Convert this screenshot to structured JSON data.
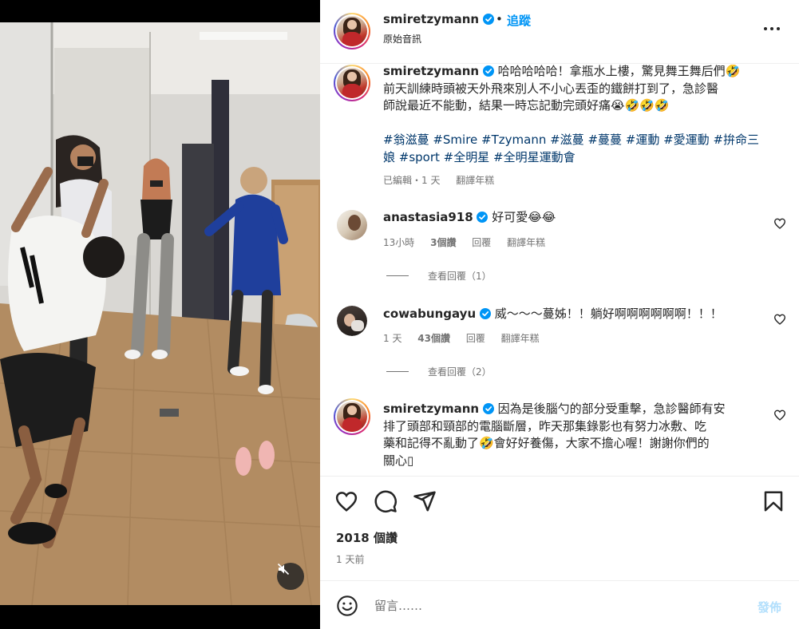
{
  "post": {
    "username": "smiretzymann",
    "follow_label": "追蹤",
    "dot": "•",
    "audio_label": "原始音訊",
    "more_icon": "more-horizontal-icon"
  },
  "caption": {
    "username": "smiretzymann",
    "line1": "哈哈哈哈哈！拿瓶水上樓，驚見舞王舞后們🤣",
    "line2": "前天訓練時頭被天外飛來別人不小心丟歪的鐵餅打到了，急診醫",
    "line3": "師說最近不能動，結果一時忘記動完頭好痛😭🤣🤣🤣",
    "hashtags_line1": "#翁滋蔓 #Smire #Tzymann #滋蔓 #蔓蔓 #運動 #愛運動 #拚命三",
    "hashtags_line2": "娘 #sport #全明星 #全明星運動會",
    "edited": "已編輯・1 天",
    "translate": "翻譯年糕"
  },
  "comments": [
    {
      "username": "anastasia918",
      "text": "好可愛😂😂",
      "time": "13小時",
      "likes": "3個讚",
      "reply": "回覆",
      "translate": "翻譯年糕",
      "view_replies": "查看回覆（1）"
    },
    {
      "username": "cowabungayu",
      "text": "威～～～蔓姊！！躺好啊啊啊啊啊啊！！！",
      "time": "1 天",
      "likes": "43個讚",
      "reply": "回覆",
      "translate": "翻譯年糕",
      "view_replies": "查看回覆（2）"
    },
    {
      "username": "smiretzymann",
      "line1": "因為是後腦勺的部分受重擊，急診醫師有安",
      "line2": "排了頭部和頸部的電腦斷層，昨天那集錄影也有努力冰敷、吃",
      "line3": "藥和記得不亂動了🤣會好好養傷，大家不擔心喔！謝謝你們的",
      "line4": "關心▯"
    }
  ],
  "footer": {
    "likes": "2018 個讚",
    "time_ago": "1 天前",
    "comment_placeholder": "留言……",
    "post_label": "發佈"
  },
  "colors": {
    "link_blue": "#0095f6",
    "hashtag": "#00376b",
    "secondary_text": "#737373",
    "post_disabled": "#b2dffc"
  }
}
